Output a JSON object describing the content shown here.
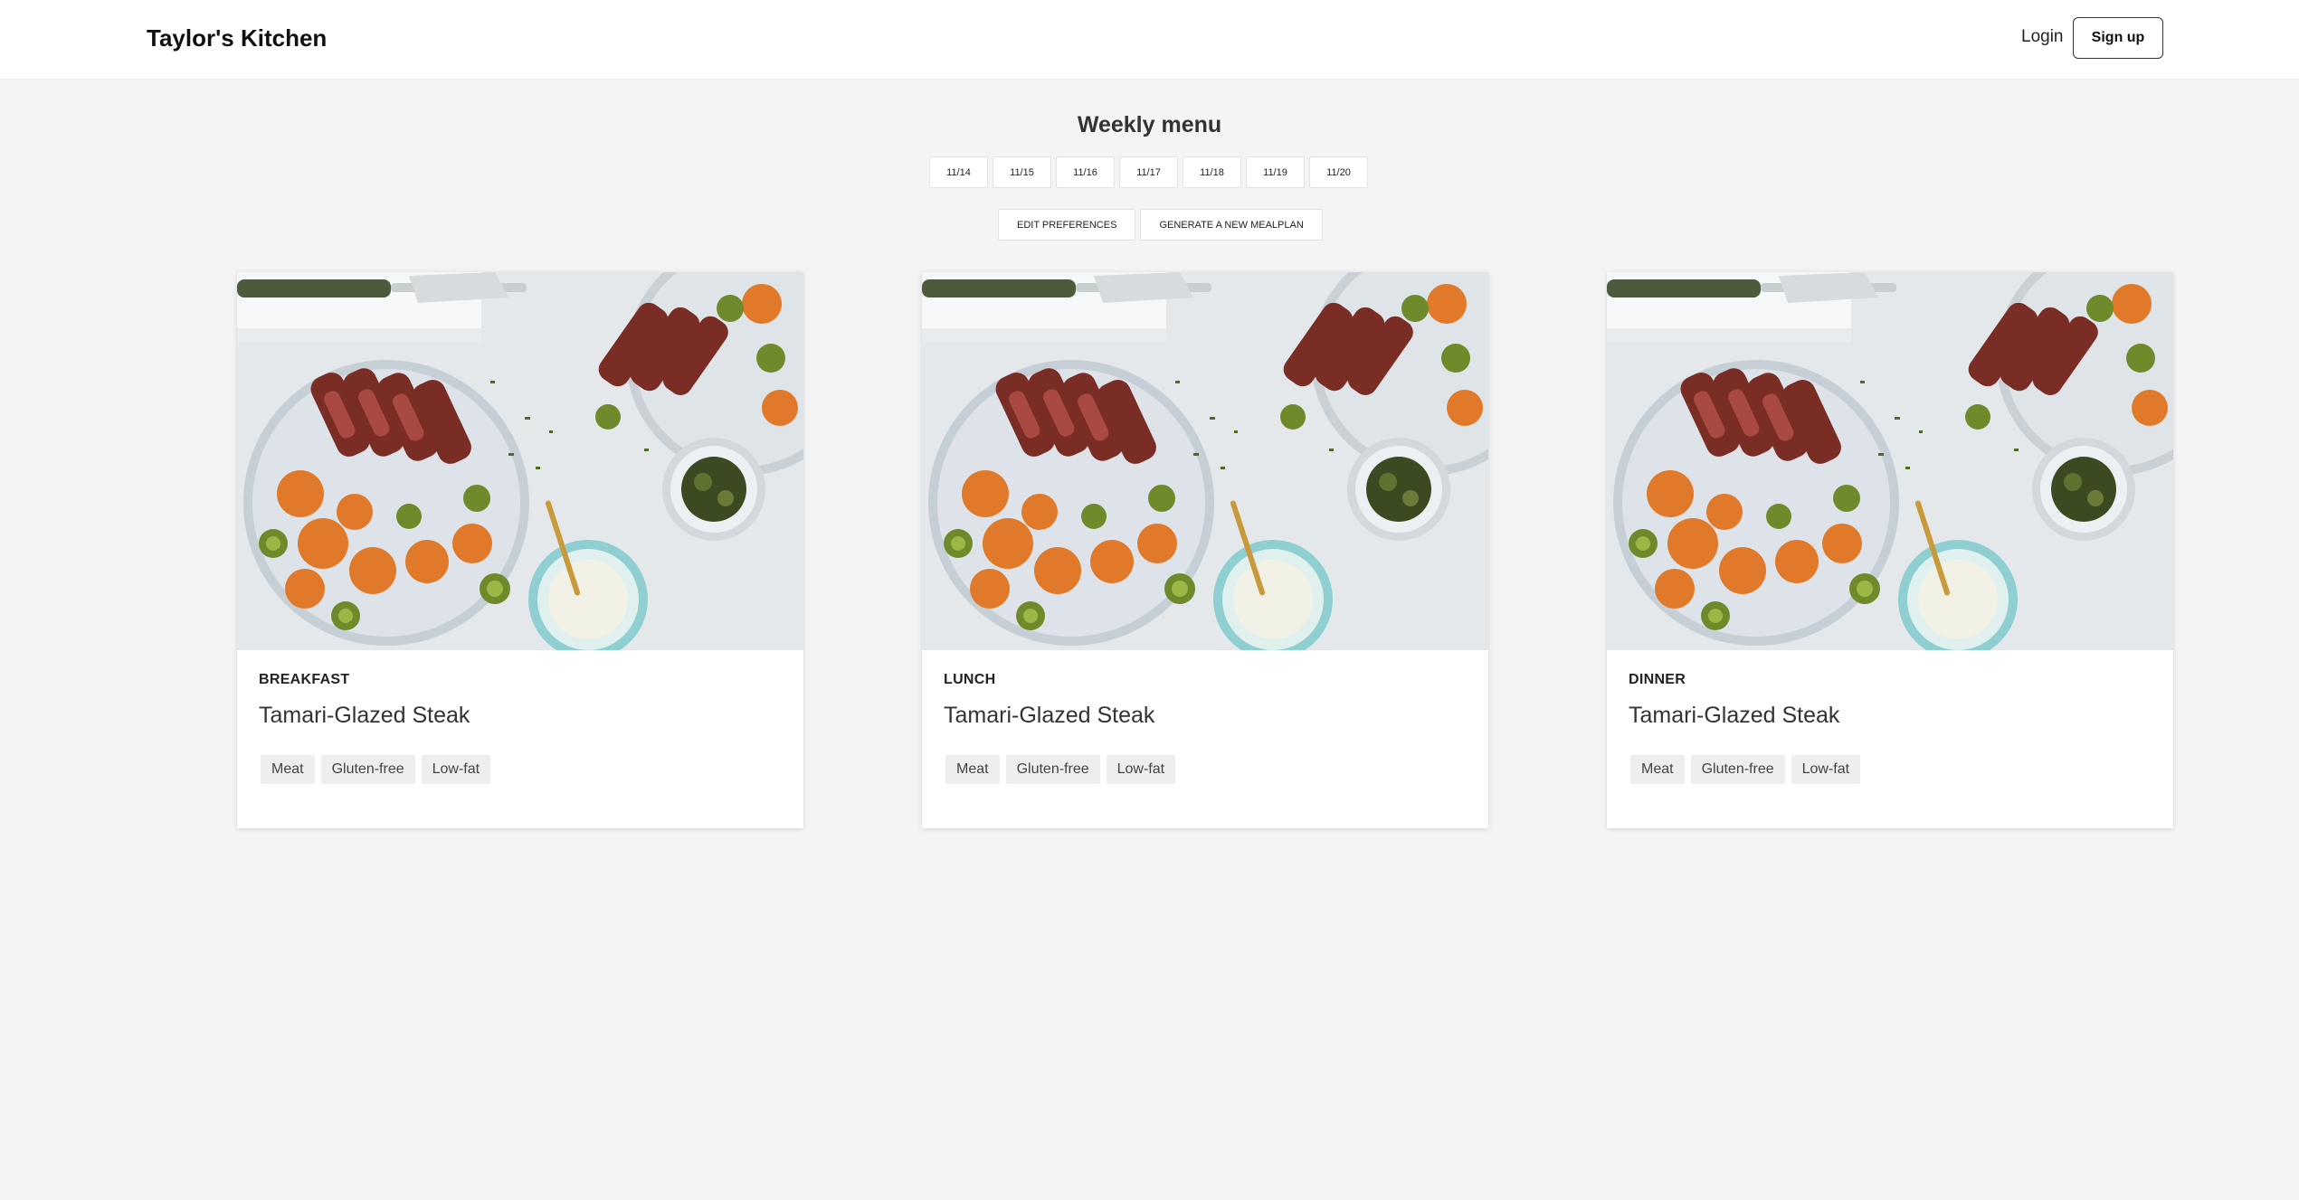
{
  "nav": {
    "brand": "Taylor's Kitchen",
    "login": "Login",
    "signup": "Sign up"
  },
  "menu": {
    "title": "Weekly menu",
    "dates": [
      "11/14",
      "11/15",
      "11/16",
      "11/17",
      "11/18",
      "11/19",
      "11/20"
    ],
    "edit_preferences": "EDIT PREFERENCES",
    "generate": "GENERATE A NEW MEALPLAN"
  },
  "meals": [
    {
      "label": "BREAKFAST",
      "name": "Tamari-Glazed Steak",
      "tags": [
        "Meat",
        "Gluten-free",
        "Low-fat"
      ]
    },
    {
      "label": "LUNCH",
      "name": "Tamari-Glazed Steak",
      "tags": [
        "Meat",
        "Gluten-free",
        "Low-fat"
      ]
    },
    {
      "label": "DINNER",
      "name": "Tamari-Glazed Steak",
      "tags": [
        "Meat",
        "Gluten-free",
        "Low-fat"
      ]
    }
  ],
  "colors": {
    "background": "#f4f4f4",
    "card": "#ffffff",
    "tag": "#eeeeef"
  }
}
